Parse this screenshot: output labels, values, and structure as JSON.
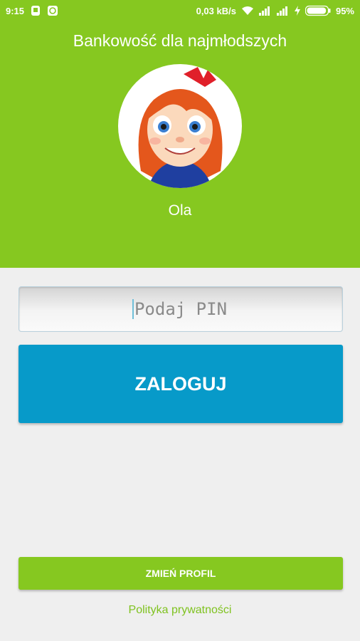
{
  "status_bar": {
    "time": "9:15",
    "network_speed": "0,03 kB/s",
    "battery_percent": "95%",
    "battery_level": 0.95,
    "left_icons": [
      "sim-storage-icon",
      "android-notification-icon"
    ],
    "right_icons": [
      "wifi-icon",
      "signal-icon",
      "signal-icon",
      "charging-icon",
      "battery-icon"
    ]
  },
  "header": {
    "title": "Bankowość dla najmłodszych",
    "profile_name": "Ola",
    "avatar": "girl-avatar-icon"
  },
  "login": {
    "pin_placeholder": "Podaj PIN",
    "pin_value": "",
    "button_label": "ZALOGUJ"
  },
  "footer": {
    "change_profile_label": "ZMIEŃ PROFIL",
    "privacy_label": "Polityka prywatności"
  },
  "colors": {
    "brand_green": "#86c820",
    "login_blue": "#079ac9",
    "background": "#efefef",
    "link_green": "#7fc21f"
  }
}
